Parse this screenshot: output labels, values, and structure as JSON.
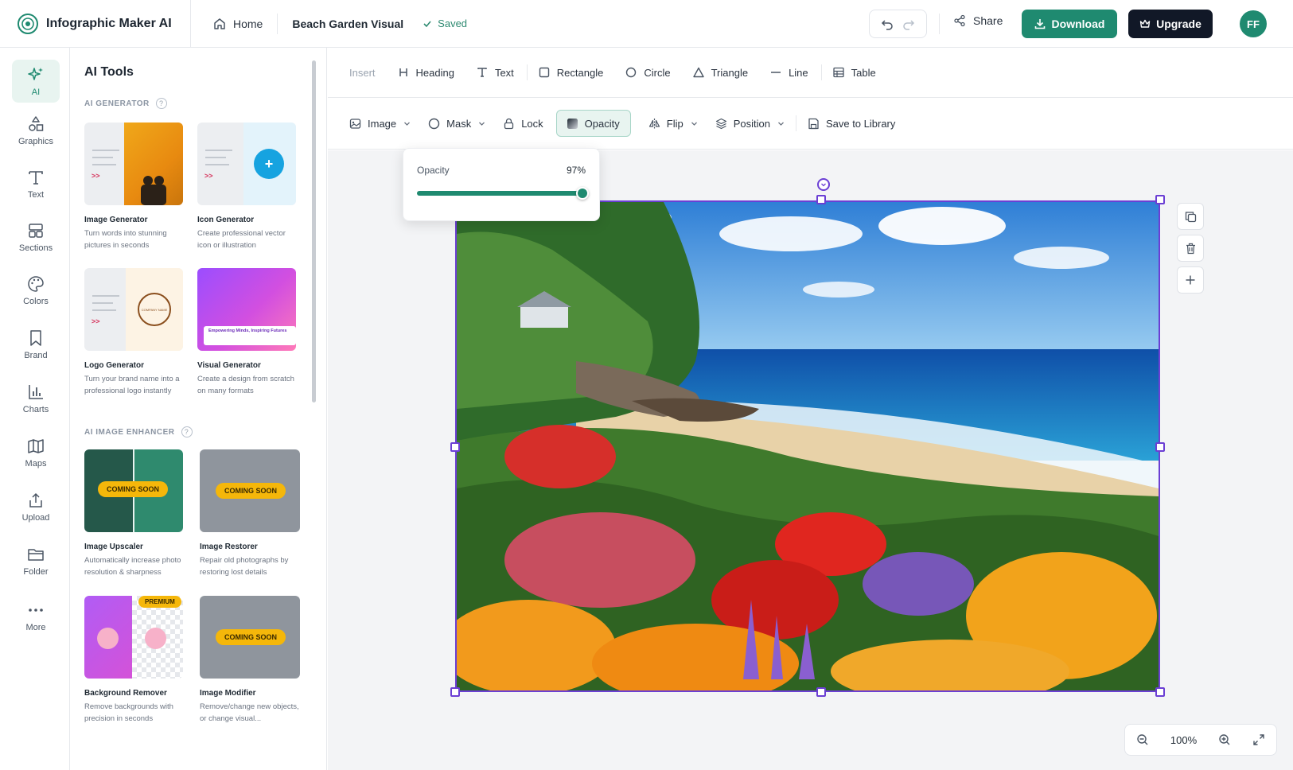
{
  "app": {
    "name": "Infographic Maker AI"
  },
  "header": {
    "home_label": "Home",
    "doc_title": "Beach Garden Visual",
    "save_status": "Saved",
    "share_label": "Share",
    "download_label": "Download",
    "upgrade_label": "Upgrade",
    "avatar_initials": "FF"
  },
  "rail": {
    "items": [
      {
        "label": "AI",
        "icon": "sparkle-icon"
      },
      {
        "label": "Graphics",
        "icon": "shapes-icon"
      },
      {
        "label": "Text",
        "icon": "text-icon"
      },
      {
        "label": "Sections",
        "icon": "sections-icon"
      },
      {
        "label": "Colors",
        "icon": "palette-icon"
      },
      {
        "label": "Brand",
        "icon": "bookmark-icon"
      },
      {
        "label": "Charts",
        "icon": "chart-icon"
      },
      {
        "label": "Maps",
        "icon": "map-icon"
      },
      {
        "label": "Upload",
        "icon": "upload-icon"
      },
      {
        "label": "Folder",
        "icon": "folder-icon"
      },
      {
        "label": "More",
        "icon": "more-icon"
      }
    ]
  },
  "panel": {
    "title": "AI Tools",
    "generator_label": "AI GENERATOR",
    "enhancer_label": "AI IMAGE ENHANCER",
    "generators": [
      {
        "title": "Image Generator",
        "desc": "Turn words into stunning pictures in seconds"
      },
      {
        "title": "Icon Generator",
        "desc": "Create professional vector icon or illustration"
      },
      {
        "title": "Logo Generator",
        "desc": "Turn your brand name into a professional logo instantly"
      },
      {
        "title": "Visual Generator",
        "desc": "Create a design from scratch on many formats"
      }
    ],
    "enhancers": [
      {
        "title": "Image Upscaler",
        "desc": "Automatically increase photo resolution & sharpness",
        "badge": "COMING SOON"
      },
      {
        "title": "Image Restorer",
        "desc": "Repair old photographs by restoring lost details",
        "badge": "COMING SOON"
      },
      {
        "title": "Background Remover",
        "desc": "Remove backgrounds with precision in seconds",
        "badge": "PREMIUM"
      },
      {
        "title": "Image Modifier",
        "desc": "Remove/change new objects, or change visual...",
        "badge": "COMING SOON"
      }
    ],
    "logo_thumb_text": "COMPANY NAME",
    "visual_thumb_text": "Empowering Minds, Inspiring Futures"
  },
  "insert_bar": {
    "label": "Insert",
    "tools": [
      "Heading",
      "Text",
      "Rectangle",
      "Circle",
      "Triangle",
      "Line",
      "Table"
    ]
  },
  "prop_bar": {
    "image": "Image",
    "mask": "Mask",
    "lock": "Lock",
    "opacity": "Opacity",
    "flip": "Flip",
    "position": "Position",
    "save_library": "Save to Library"
  },
  "opacity_popover": {
    "label": "Opacity",
    "value_text": "97%",
    "value": 0.97
  },
  "zoom": {
    "level": "100%"
  },
  "colors": {
    "accent": "#1f8a70",
    "selection": "#6b3fd4",
    "dark": "#111827"
  }
}
